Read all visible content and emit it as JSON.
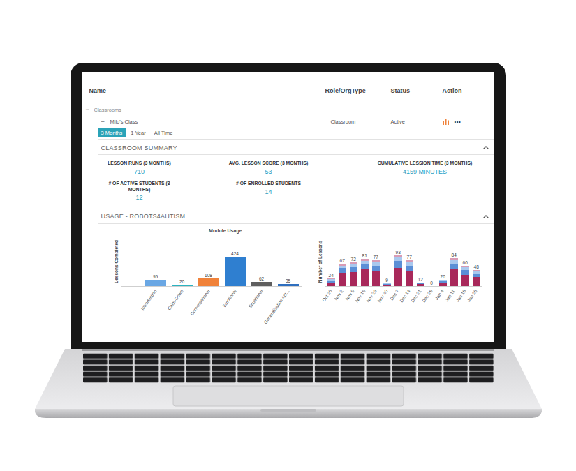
{
  "table": {
    "columns": [
      "Name",
      "Role/OrgType",
      "Status",
      "Action"
    ]
  },
  "tree": {
    "group": {
      "toggle": "−",
      "label": "Classrooms",
      "expanded": true
    },
    "classroom": {
      "toggle": "−",
      "name": "Milo's Class",
      "role": "Classroom",
      "status": "Active",
      "more": "•••",
      "expanded": true
    }
  },
  "periods": [
    {
      "label": "3 Months",
      "selected": true
    },
    {
      "label": "1 Year",
      "selected": false
    },
    {
      "label": "All Time",
      "selected": false
    }
  ],
  "summary": {
    "title": "CLASSROOM SUMMARY",
    "expanded": true,
    "stats": [
      {
        "label": "LESSON RUNS (3 MONTHS)",
        "value": "710"
      },
      {
        "label": "AVG. LESSON SCORE (3 MONTHS)",
        "value": "53"
      },
      {
        "label": "CUMULATIVE LESSION TIME (3 MONTHS)",
        "value": "4159 MINUTES"
      },
      {
        "label": "# OF ACTIVE STUDENTS (3 MONTHS)",
        "value": "12"
      },
      {
        "label": "# OF ENROLLED STUDENTS",
        "value": "14"
      }
    ]
  },
  "usage": {
    "title": "USAGE - ROBOTS4AUTISM",
    "expanded": true,
    "module_chart": {
      "title": "Module Usage",
      "y_label": "Lessons Completed",
      "bars": [
        {
          "label": "Introduction",
          "value_text": "95",
          "value": 95,
          "color": "#6aa7e4"
        },
        {
          "label": "Calm-Down",
          "value_text": "20",
          "value": 20,
          "color": "#2bb3c0"
        },
        {
          "label": "Conversational",
          "value_text": "108",
          "value": 108,
          "color": "#f0823a"
        },
        {
          "label": "Emotional",
          "value_text": "424",
          "value": 424,
          "color": "#2f7fd0"
        },
        {
          "label": "Situational",
          "value_text": "62",
          "value": 62,
          "color": "#5f5f5f"
        },
        {
          "label": "Generalization Act...",
          "value_text": "35",
          "value": 35,
          "color": "#2f6fbf"
        }
      ]
    },
    "weekly_chart": {
      "y_label": "Number of Lessons",
      "series": [
        {
          "color": "#a8285a",
          "values": [
            12,
            40,
            42,
            50,
            46,
            5,
            55,
            46,
            7,
            0,
            11,
            50,
            34,
            27
          ]
        },
        {
          "color": "#5b8fd6",
          "values": [
            6,
            14,
            15,
            16,
            16,
            2,
            20,
            16,
            3,
            0,
            5,
            18,
            14,
            11
          ]
        },
        {
          "color": "#a9c8ee",
          "values": [
            4,
            8,
            10,
            10,
            10,
            1,
            12,
            10,
            1,
            0,
            3,
            10,
            8,
            6
          ]
        },
        {
          "color": "#d89bb5",
          "values": [
            2,
            5,
            5,
            5,
            5,
            1,
            6,
            5,
            1,
            0,
            1,
            6,
            4,
            4
          ]
        }
      ],
      "weeks": [
        {
          "label": "Oct 26",
          "total": "24"
        },
        {
          "label": "Nov 2",
          "total": "67"
        },
        {
          "label": "Nov 9",
          "total": "72"
        },
        {
          "label": "Nov 16",
          "total": "81"
        },
        {
          "label": "Nov 23",
          "total": "77"
        },
        {
          "label": "Nov 30",
          "total": "9"
        },
        {
          "label": "Dec 7",
          "total": "93"
        },
        {
          "label": "Dec 14",
          "total": "77"
        },
        {
          "label": "Dec 21",
          "total": "12"
        },
        {
          "label": "Dec 28",
          "total": "0"
        },
        {
          "label": "Jan 4",
          "total": "20"
        },
        {
          "label": "Jan 11",
          "total": "84"
        },
        {
          "label": "Jan 18",
          "total": "60"
        },
        {
          "label": "Jan 25",
          "total": "48"
        }
      ]
    }
  }
}
